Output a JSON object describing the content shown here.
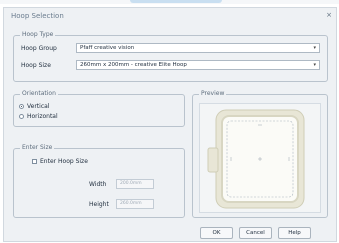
{
  "window": {
    "title": "Hoop Selection",
    "close_glyph": "×"
  },
  "hoop_type": {
    "legend": "Hoop Type",
    "group_label": "Hoop Group",
    "group_value": "Pfaff creative vision",
    "size_label": "Hoop Size",
    "size_value": "260mm x 200mm - creative Elite Hoop"
  },
  "orientation": {
    "legend": "Orientation",
    "options": [
      {
        "label": "Vertical",
        "selected": true
      },
      {
        "label": "Horizontal",
        "selected": false
      }
    ]
  },
  "enter_size": {
    "legend": "Enter Size",
    "checkbox_label": "Enter Hoop Size",
    "checked": false,
    "width_label": "Width",
    "width_value": "200.0mm",
    "height_label": "Height",
    "height_value": "260.0mm"
  },
  "preview": {
    "legend": "Preview"
  },
  "buttons": {
    "ok": "OK",
    "cancel": "Cancel",
    "help": "Help"
  },
  "colors": {
    "hoop_frame": "#e2e0cd",
    "preview_bg": "#f3f5f6",
    "accent": "#c9dff1"
  }
}
